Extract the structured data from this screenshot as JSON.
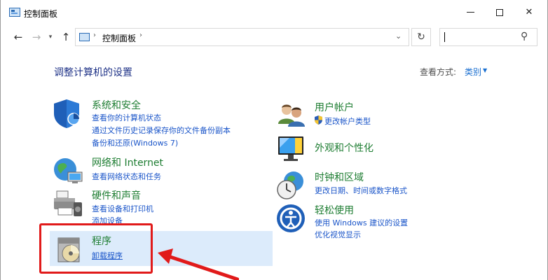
{
  "window": {
    "title": "控制面板"
  },
  "nav": {
    "back_icon": "back-arrow-icon",
    "forward_icon": "forward-arrow-icon",
    "recent_icon": "chevron-down-icon",
    "up_icon": "up-arrow-icon"
  },
  "address": {
    "path": "控制面板",
    "separator": "›"
  },
  "search": {
    "value": ""
  },
  "main": {
    "heading": "调整计算机的设置",
    "view_by_label": "查看方式:",
    "view_by_value": "类别"
  },
  "categories": {
    "system": {
      "title": "系统和安全",
      "links": [
        "查看你的计算机状态",
        "通过文件历史记录保存你的文件备份副本",
        "备份和还原(Windows 7)"
      ]
    },
    "network": {
      "title": "网络和 Internet",
      "links": [
        "查看网络状态和任务"
      ]
    },
    "hardware": {
      "title": "硬件和声音",
      "links": [
        "查看设备和打印机",
        "添加设备"
      ]
    },
    "programs": {
      "title": "程序",
      "links": [
        "卸载程序"
      ]
    },
    "users": {
      "title": "用户帐户",
      "links": [
        "更改帐户类型"
      ]
    },
    "appearance": {
      "title": "外观和个性化",
      "links": []
    },
    "clock": {
      "title": "时钟和区域",
      "links": [
        "更改日期、时间或数字格式"
      ]
    },
    "ease": {
      "title": "轻松使用",
      "links": [
        "使用 Windows 建议的设置",
        "优化视觉显示"
      ]
    }
  },
  "colors": {
    "heading": "#1e3287",
    "category_title": "#1e7d32",
    "link": "#1a55c9",
    "highlight": "#dcebfb",
    "annotation": "#e11a1a"
  }
}
